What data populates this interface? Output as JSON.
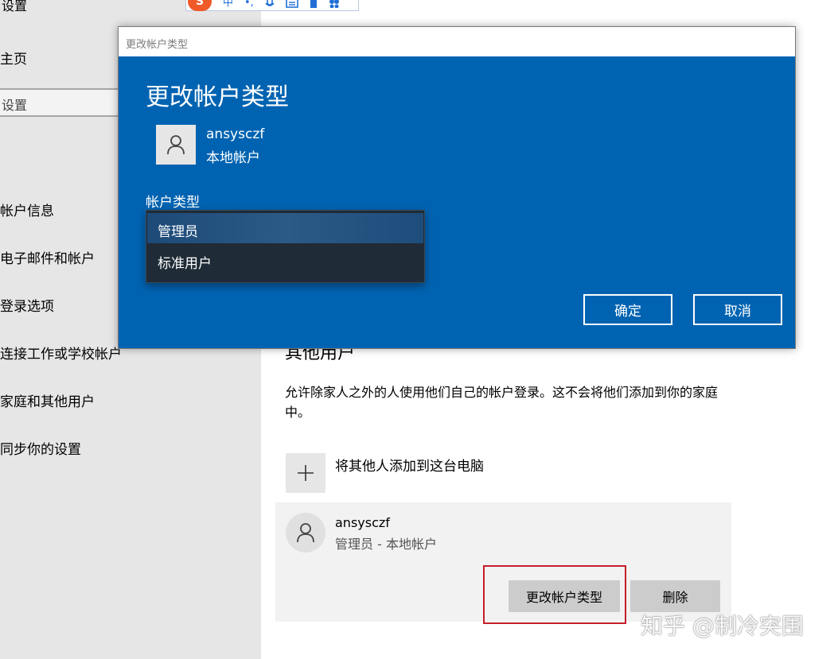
{
  "sidebar": {
    "title": "设置",
    "home": "主页",
    "search_placeholder": "设置",
    "items": [
      "帐户信息",
      "电子邮件和帐户",
      "登录选项",
      "连接工作或学校帐户",
      "家庭和其他用户",
      "同步你的设置"
    ]
  },
  "ime": {
    "logo": "S",
    "glyphs": [
      "中",
      "•,",
      "mic-icon",
      "keyboard-icon",
      "shirt-icon",
      "apps-icon"
    ]
  },
  "main": {
    "heading": "其他用户",
    "description": "允许除家人之外的人使用他们自己的帐户登录。这不会将他们添加到你的家庭中。",
    "add_label": "将其他人添加到这台电脑",
    "user_card": {
      "name": "ansysczf",
      "subtitle": "管理员 - 本地帐户",
      "change_type_label": "更改帐户类型",
      "delete_label": "删除"
    }
  },
  "dialog": {
    "window_title": "更改帐户类型",
    "heading": "更改帐户类型",
    "username": "ansysczf",
    "account_kind": "本地帐户",
    "type_label": "帐户类型",
    "options": [
      "管理员",
      "标准用户"
    ],
    "selected_option": "管理员",
    "ok_label": "确定",
    "cancel_label": "取消"
  },
  "watermark": "知乎 @制冷突围",
  "colors": {
    "dialog_blue": "#0063b1",
    "sidebar_bg": "#e6e6e6",
    "highlight_red": "#c41e2a",
    "dropdown_bg": "#1f2b36",
    "dropdown_selected": "#2c5a86"
  }
}
